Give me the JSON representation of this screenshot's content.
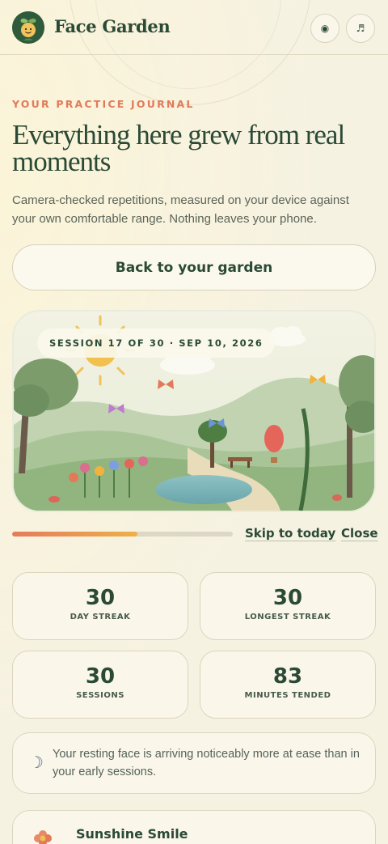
{
  "header": {
    "brand": "Face Garden",
    "buttons": [
      {
        "icon": "record-icon",
        "glyph": "◉"
      },
      {
        "icon": "music-note-icon",
        "glyph": "♬"
      }
    ]
  },
  "journal": {
    "eyebrow": "YOUR PRACTICE JOURNAL",
    "title": "Everything here grew from real moments",
    "intro": "Camera-checked repetitions, measured on your device against your own comfortable range. Nothing leaves your phone.",
    "back_label": "Back to your garden"
  },
  "scene": {
    "session_label": "SESSION 17 OF 30 · SEP 10, 2026"
  },
  "progress": {
    "fraction": 0.567,
    "skip_label": "Skip to today",
    "close_label": "Close"
  },
  "stats": [
    {
      "value": "30",
      "label": "DAY STREAK"
    },
    {
      "value": "30",
      "label": "LONGEST STREAK"
    },
    {
      "value": "30",
      "label": "SESSIONS"
    },
    {
      "value": "83",
      "label": "MINUTES TENDED"
    }
  ],
  "note": {
    "icon": "moon-icon",
    "glyph": "☽",
    "text": "Your resting face is arriving noticeably more at ease than in your early sessions."
  },
  "exercise": {
    "icon": "flower-icon",
    "title": "Sunshine Smile"
  },
  "colors": {
    "background": "#f6f2e2",
    "accent": "#e27a5a",
    "brand_green": "#2b4a36",
    "progress_start": "#e57b5d",
    "progress_end": "#edb04a"
  }
}
